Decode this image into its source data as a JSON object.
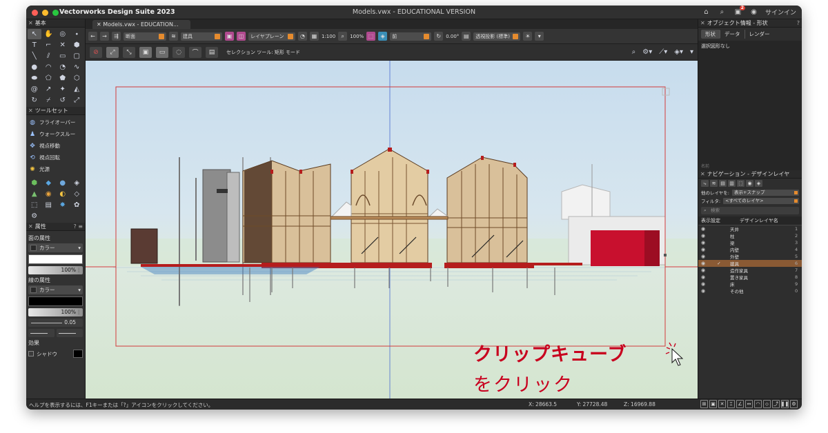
{
  "window": {
    "app_name": "Vectorworks Design Suite 2023",
    "document_title": "Models.vwx - EDUCATIONAL VERSION",
    "sign_in": "サインイン",
    "notification_count": "2"
  },
  "tab": {
    "label": "Models.vwx - EDUCATION..."
  },
  "view_bar": {
    "saved_view": "断面",
    "class": "建具",
    "layer_plane": "レイヤプレーン",
    "scale": "1:100",
    "zoom": "100%",
    "view": "前",
    "rotation": "0.00°",
    "projection": "透視投影 (標準)"
  },
  "mode_bar": {
    "mode_label": "セレクション ツール: 矩形 モード"
  },
  "palettes": {
    "basic": {
      "title": "基本"
    },
    "toolsets": {
      "title": "ツールセット",
      "items": [
        {
          "label": "フライオーバー",
          "icon": "flyover-icon"
        },
        {
          "label": "ウォークスルー",
          "icon": "walkthrough-icon"
        },
        {
          "label": "視点移動",
          "icon": "translate-view-icon"
        },
        {
          "label": "視点回転",
          "icon": "rotate-view-icon"
        },
        {
          "label": "光源",
          "icon": "light-icon"
        }
      ]
    },
    "attributes": {
      "title": "属性",
      "fill_label": "面の属性",
      "fill_type": "カラー",
      "fill_opacity": "100%",
      "line_label": "線の属性",
      "line_type": "カラー",
      "line_opacity": "100%",
      "line_weight": "0.05",
      "effects_label": "効果",
      "shadow_label": "シャドウ"
    }
  },
  "object_info": {
    "title": "オブジェクト情報 - 形状",
    "tabs": [
      "形状",
      "データ",
      "レンダー"
    ],
    "selection": "選択図形なし",
    "footer": "名前"
  },
  "navigation": {
    "title": "ナビゲーション - デザインレイヤ",
    "other_layers_label": "他のレイヤを:",
    "other_layers_value": "表示+スナップ",
    "filter_label": "フィルタ:",
    "filter_value": "<すべてのレイヤ>",
    "search_placeholder": "検索",
    "col_visibility": "表示設定",
    "col_name": "デザインレイヤ名",
    "layers": [
      {
        "name": "天井",
        "num": "1",
        "active": false
      },
      {
        "name": "柱",
        "num": "2",
        "active": false
      },
      {
        "name": "梁",
        "num": "3",
        "active": false
      },
      {
        "name": "内壁",
        "num": "4",
        "active": false
      },
      {
        "name": "外壁",
        "num": "5",
        "active": false
      },
      {
        "name": "建具",
        "num": "6",
        "active": true
      },
      {
        "name": "造作家具",
        "num": "7",
        "active": false
      },
      {
        "name": "置き家具",
        "num": "8",
        "active": false
      },
      {
        "name": "床",
        "num": "9",
        "active": false
      },
      {
        "name": "その他",
        "num": "0",
        "active": false
      }
    ]
  },
  "status": {
    "help": "ヘルプを表示するには、F1キーまたは「?」アイコンをクリックしてください。",
    "x": "X: 28663.5",
    "y": "Y: 27728.48",
    "z": "Z: 16969.88"
  },
  "annotation": {
    "line1": "クリップキューブ",
    "line2": "をクリック",
    "color": "#c8001e"
  }
}
